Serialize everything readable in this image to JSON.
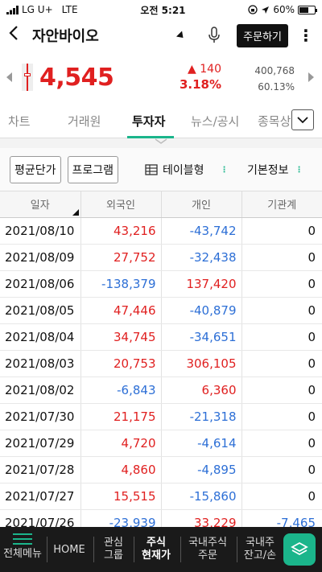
{
  "status_bar": {
    "carrier": "LG U+",
    "network": "LTE",
    "time": "오전 5:21",
    "battery": "60%",
    "battery_level": 0.6
  },
  "header": {
    "stock_name": "자안바이오",
    "order_label": "주문하기",
    "more_label": "⋮"
  },
  "quote": {
    "price": "4,545",
    "change": "▲ 140",
    "change_pct": "3.18%",
    "volume": "400,768",
    "volume_ratio": "60.13%"
  },
  "tabs": [
    {
      "label": "차트"
    },
    {
      "label": "거래원"
    },
    {
      "label": "투자자"
    },
    {
      "label": "뉴스/공시"
    },
    {
      "label": "종목상"
    }
  ],
  "active_tab": "투자자",
  "toolbar": {
    "avg_price_label": "평균단가",
    "program_label": "프로그램",
    "table_mode_label": "테이블형",
    "basic_info_label": "기본정보",
    "basic_info_dots": "⋮"
  },
  "table": {
    "columns": [
      "일자",
      "외국인",
      "개인",
      "기관계"
    ],
    "rows": [
      {
        "date": "2021/08/10",
        "foreign": "43,216",
        "individual": "-43,742",
        "institution": "0"
      },
      {
        "date": "2021/08/09",
        "foreign": "27,752",
        "individual": "-32,438",
        "institution": "0"
      },
      {
        "date": "2021/08/06",
        "foreign": "-138,379",
        "individual": "137,420",
        "institution": "0"
      },
      {
        "date": "2021/08/05",
        "foreign": "47,446",
        "individual": "-40,879",
        "institution": "0"
      },
      {
        "date": "2021/08/04",
        "foreign": "34,745",
        "individual": "-34,651",
        "institution": "0"
      },
      {
        "date": "2021/08/03",
        "foreign": "20,753",
        "individual": "306,105",
        "institution": "0"
      },
      {
        "date": "2021/08/02",
        "foreign": "-6,843",
        "individual": "6,360",
        "institution": "0"
      },
      {
        "date": "2021/07/30",
        "foreign": "21,175",
        "individual": "-21,318",
        "institution": "0"
      },
      {
        "date": "2021/07/29",
        "foreign": "4,720",
        "individual": "-4,614",
        "institution": "0"
      },
      {
        "date": "2021/07/28",
        "foreign": "4,860",
        "individual": "-4,895",
        "institution": "0"
      },
      {
        "date": "2021/07/27",
        "foreign": "15,515",
        "individual": "-15,860",
        "institution": "0"
      },
      {
        "date": "2021/07/26",
        "foreign": "-23,939",
        "individual": "33,229",
        "institution": "-7,465"
      }
    ]
  },
  "bottom_nav": [
    {
      "label": "전체메뉴",
      "icon": "hamburger-icon"
    },
    {
      "label": "HOME"
    },
    {
      "label": "관심\n그룹"
    },
    {
      "label": "주식\n현재가",
      "active": true
    },
    {
      "label": "국내주식\n주문"
    },
    {
      "label": "국내주\n잔고/손"
    }
  ],
  "colors": {
    "up": "#e02020",
    "down": "#2d6fd6",
    "accent": "#1bb58b"
  }
}
